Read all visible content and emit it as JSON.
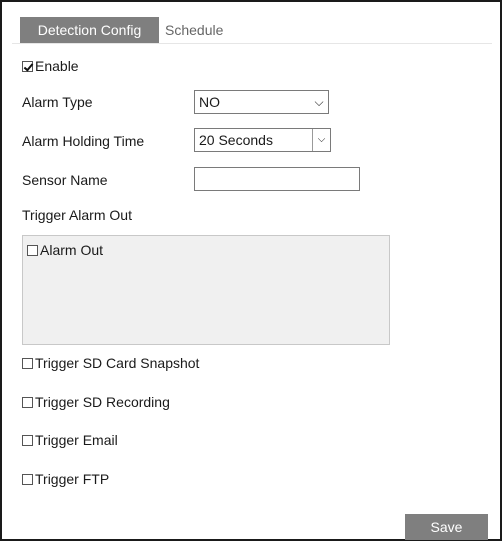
{
  "tabs": [
    {
      "label": "Detection Config",
      "active": true
    },
    {
      "label": "Schedule",
      "active": false
    }
  ],
  "enable": {
    "label": "Enable",
    "checked": true
  },
  "alarm_type": {
    "label": "Alarm Type",
    "value": "NO"
  },
  "holding_time": {
    "label": "Alarm Holding Time",
    "value": "20 Seconds"
  },
  "sensor_name": {
    "label": "Sensor Name",
    "value": ""
  },
  "trigger_alarm_out": {
    "label": "Trigger Alarm Out",
    "items": [
      {
        "label": "Alarm Out",
        "checked": false
      }
    ]
  },
  "triggers": {
    "sd_snapshot": {
      "label": "Trigger SD Card Snapshot",
      "checked": false
    },
    "sd_recording": {
      "label": "Trigger SD Recording",
      "checked": false
    },
    "email": {
      "label": "Trigger Email",
      "checked": false
    },
    "ftp": {
      "label": "Trigger FTP",
      "checked": false
    }
  },
  "save_label": "Save",
  "colors": {
    "tab_active_bg": "#7f7f7f",
    "button_bg": "#7f7f7f",
    "frame_border": "#1a1a1a"
  }
}
